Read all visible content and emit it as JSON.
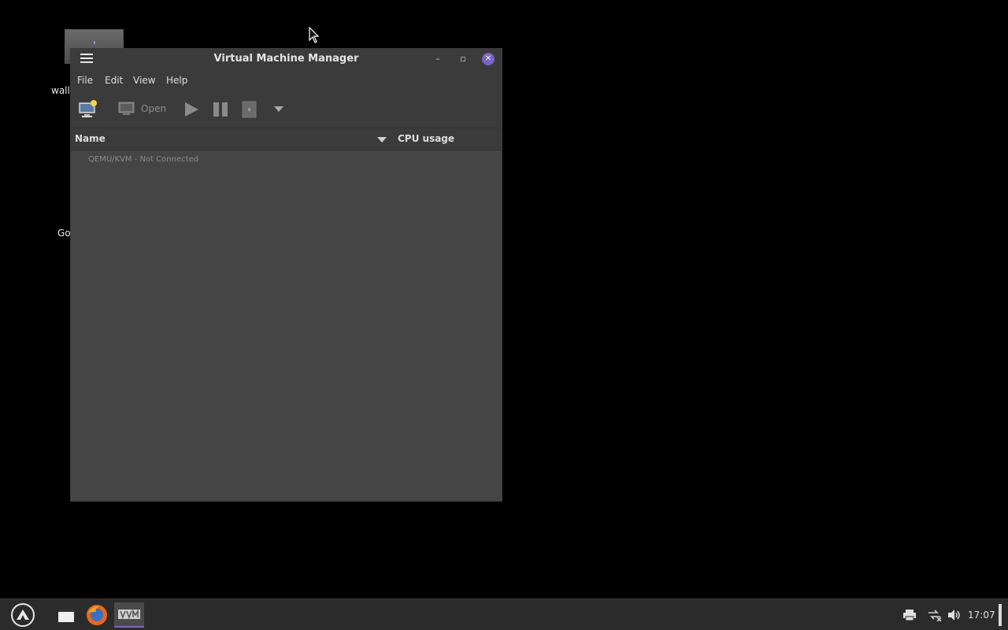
{
  "desktop": {
    "icons": [
      {
        "label": "wall"
      },
      {
        "label": "Go"
      }
    ]
  },
  "window": {
    "title": "Virtual Machine Manager",
    "menu": [
      "File",
      "Edit",
      "View",
      "Help"
    ],
    "toolbar": {
      "open_label": "Open"
    },
    "columns": {
      "name": "Name",
      "cpu": "CPU usage"
    },
    "connections": [
      {
        "label": "QEMU/KVM - Not Connected"
      }
    ]
  },
  "taskbar": {
    "clock": "17:07",
    "accent_color": "#7b64c0"
  }
}
